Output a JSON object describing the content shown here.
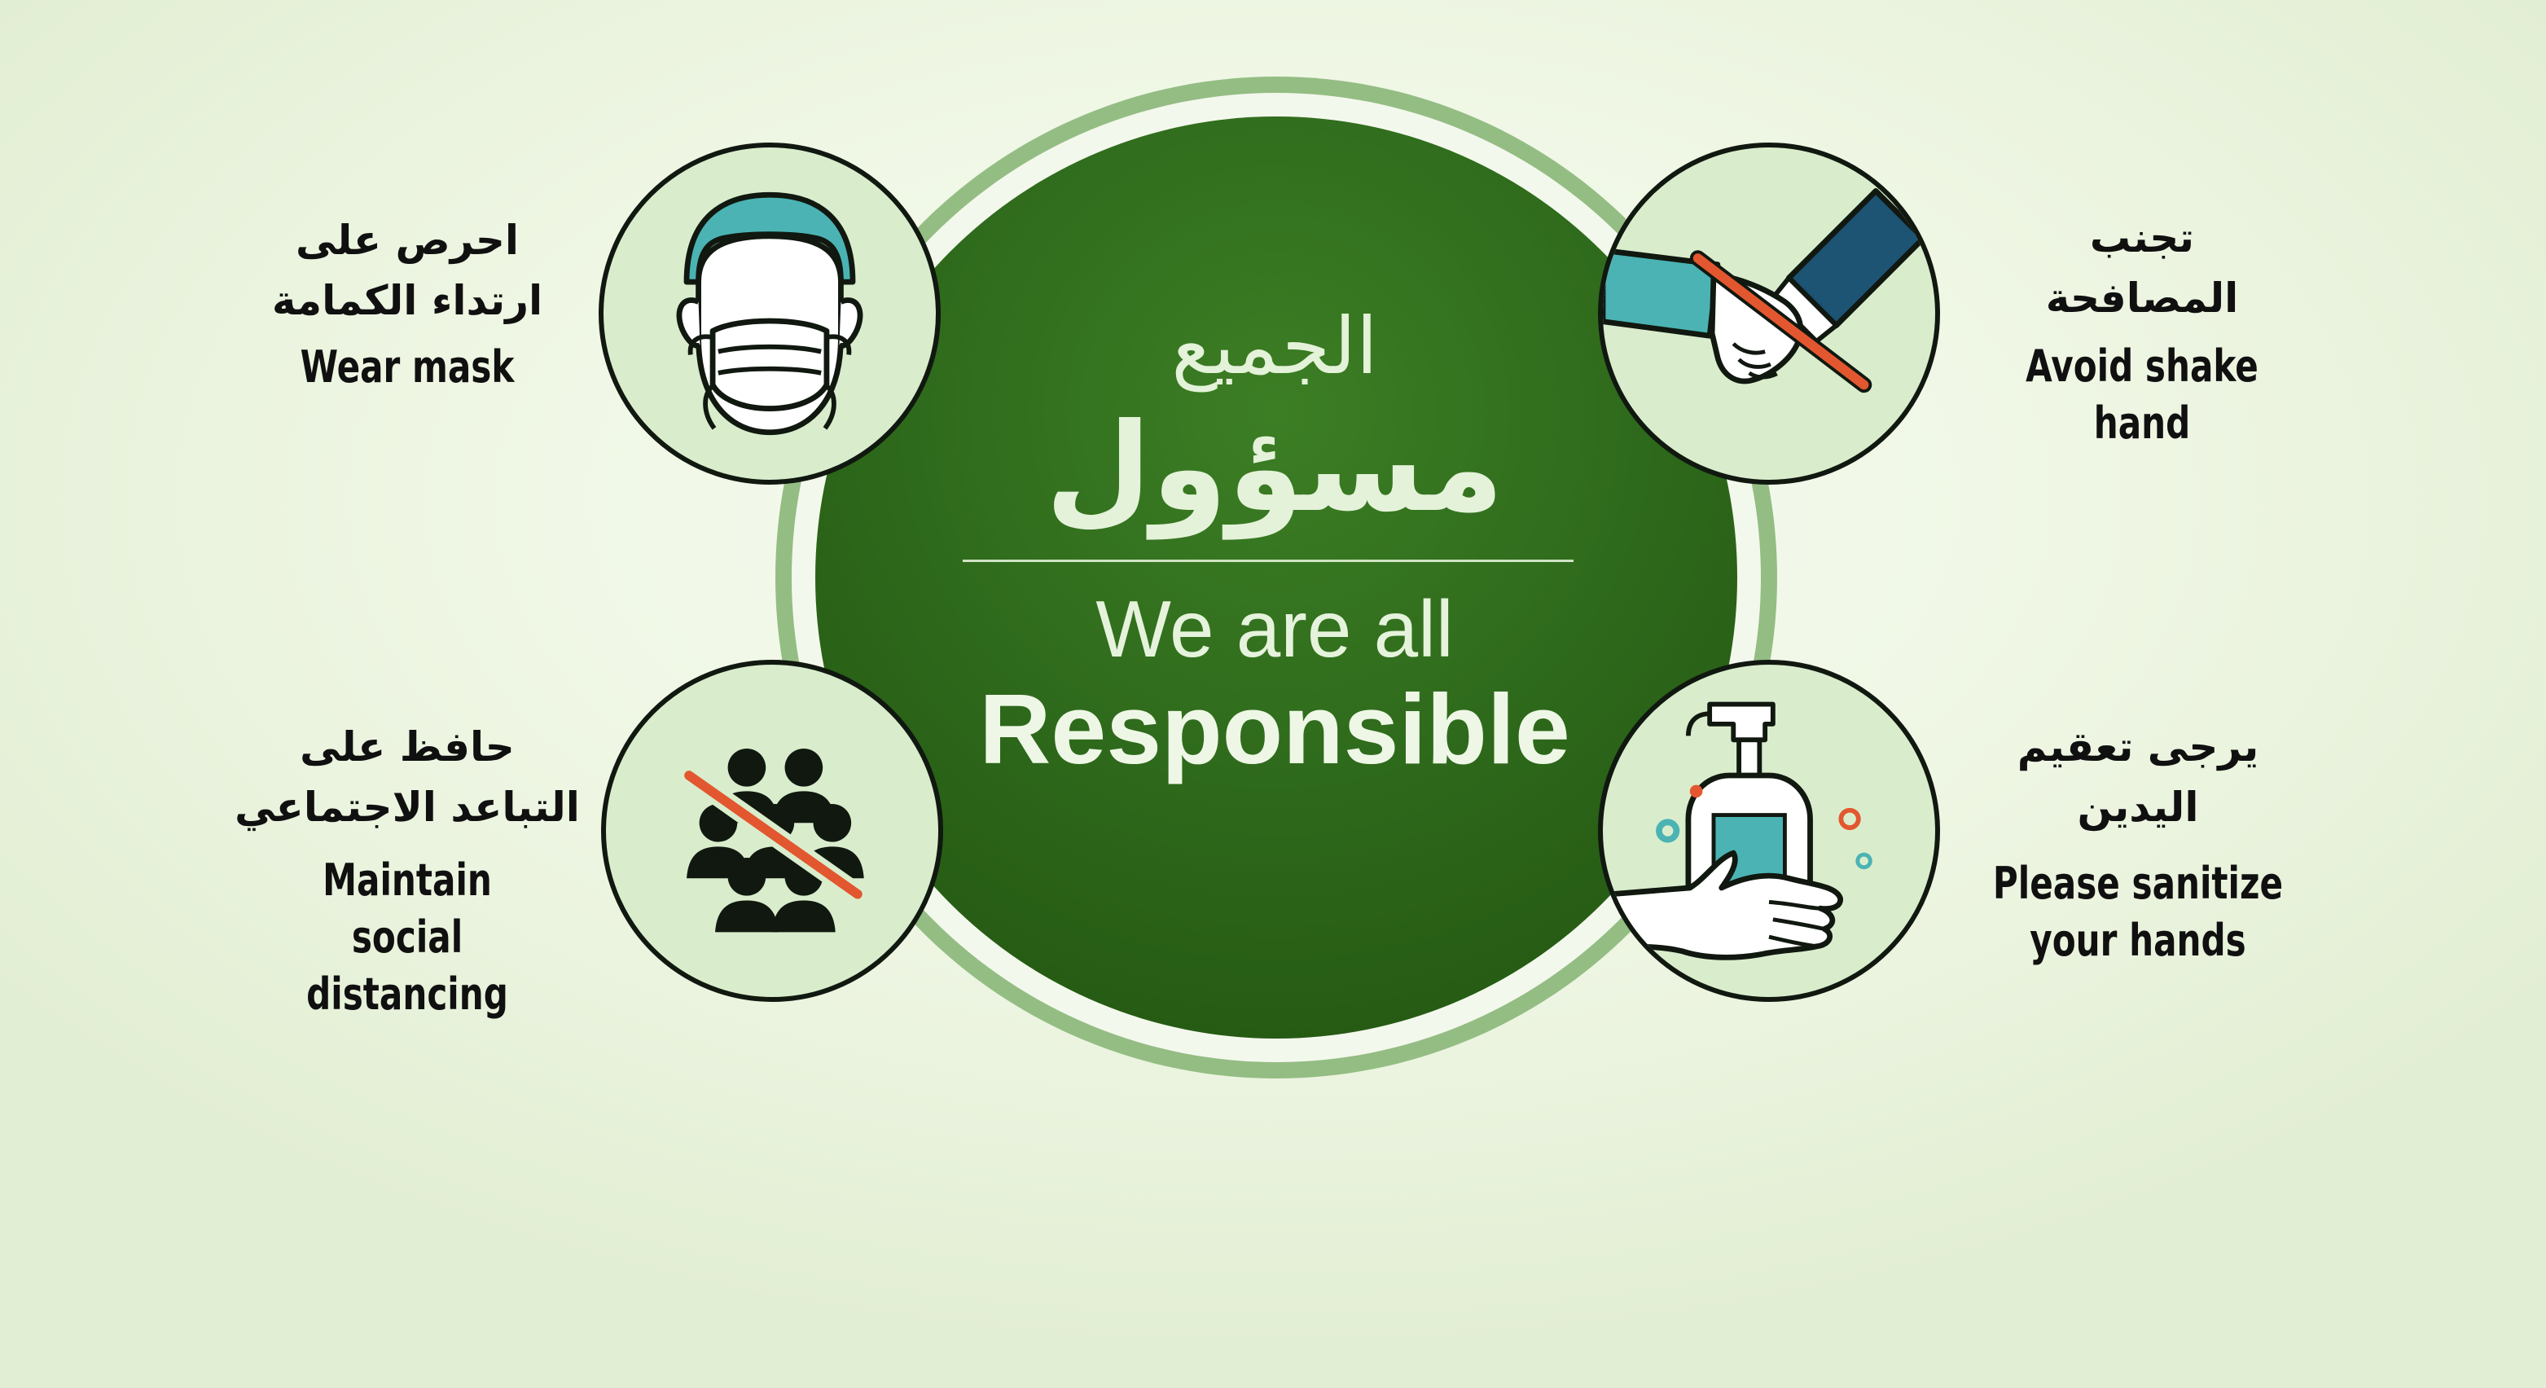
{
  "center": {
    "arabic_line1": "الجميع",
    "arabic_line2": "مسؤول",
    "english_line1": "We are all",
    "english_line2": "Responsible"
  },
  "tips": {
    "mask": {
      "arabic_line1": "احرص على",
      "arabic_line2": "ارتداء الكمامة",
      "english": "Wear mask",
      "icon": "face-mask-icon"
    },
    "handshake": {
      "arabic_line1": "تجنب",
      "arabic_line2": "المصافحة",
      "english": "Avoid shake hand",
      "icon": "no-handshake-icon"
    },
    "distancing": {
      "arabic_line1": "حافظ على",
      "arabic_line2": "التباعد الاجتماعي",
      "english_line1": "Maintain",
      "english_line2": "social distancing",
      "icon": "no-crowd-icon"
    },
    "sanitize": {
      "arabic_line1": "يرجى تعقيم",
      "arabic_line2": "اليدين",
      "english_line1": "Please sanitize",
      "english_line2": "your hands",
      "icon": "hand-sanitizer-icon"
    }
  },
  "colors": {
    "brand_green": "#2f6b1c",
    "ring_green": "#94bd84",
    "icon_bg": "#d9edcc",
    "teal": "#4bb3b3",
    "dark_teal": "#1d5373",
    "prohibit_red": "#e2572f"
  }
}
